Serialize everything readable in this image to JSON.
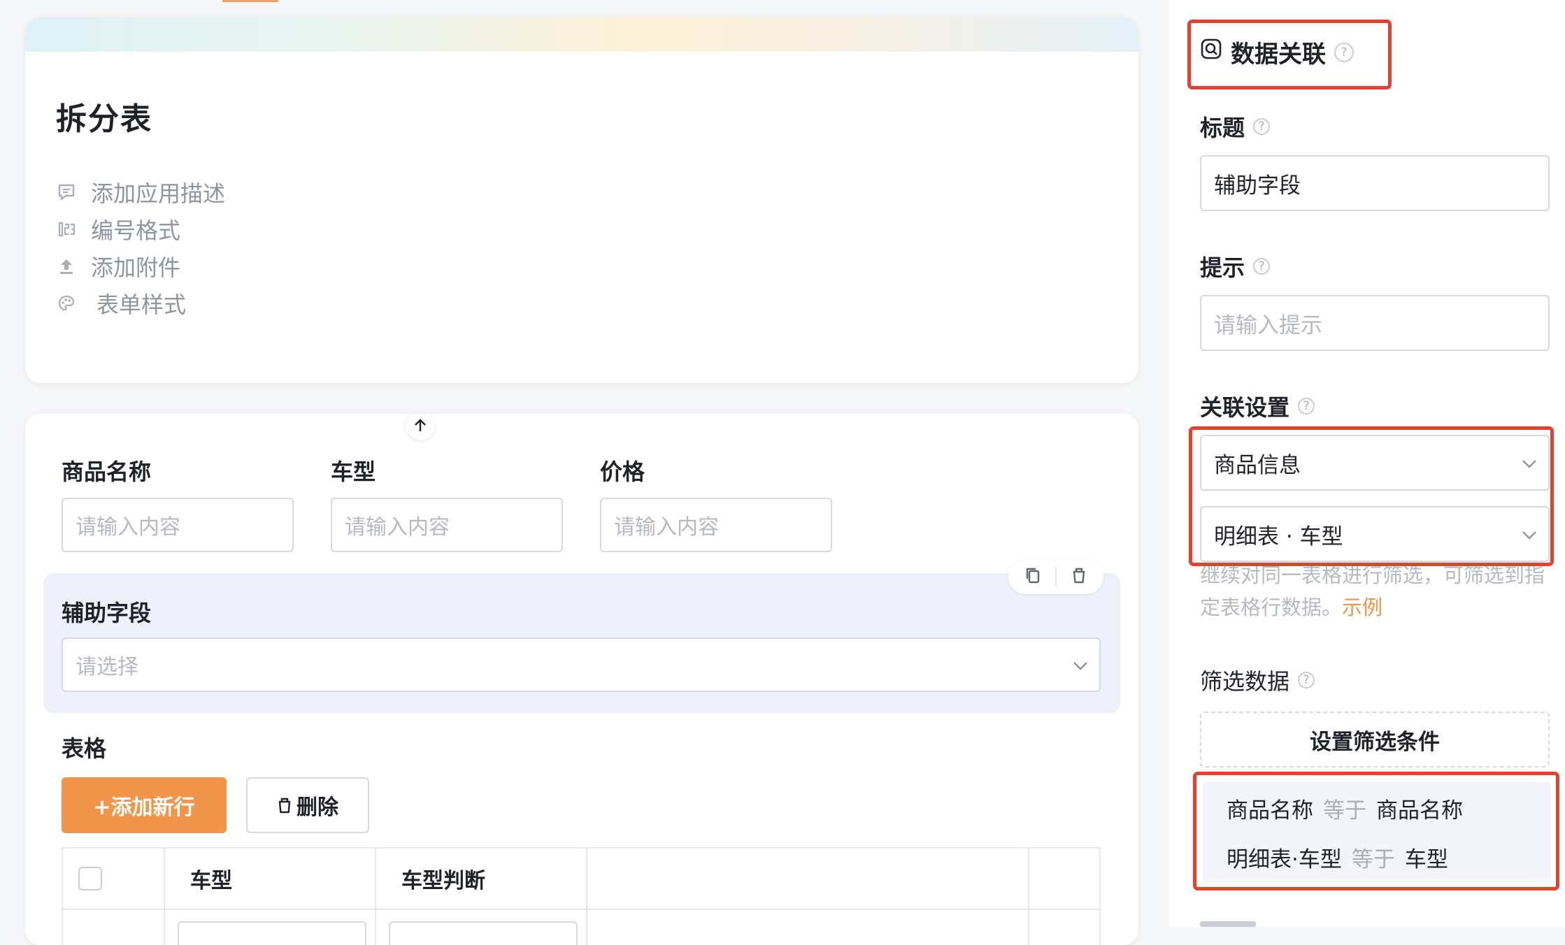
{
  "form": {
    "title": "拆分表",
    "meta": [
      {
        "icon": "comment-icon",
        "label": "添加应用描述"
      },
      {
        "icon": "number-format-icon",
        "label": "编号格式"
      },
      {
        "icon": "upload-icon",
        "label": "添加附件"
      },
      {
        "icon": "palette-icon",
        "label": "表单样式"
      }
    ]
  },
  "fields": [
    {
      "label": "商品名称",
      "placeholder": "请输入内容"
    },
    {
      "label": "车型",
      "placeholder": "请输入内容"
    },
    {
      "label": "价格",
      "placeholder": "请输入内容"
    }
  ],
  "selected_field": {
    "label": "辅助字段",
    "placeholder": "请选择",
    "toolbar_icons": [
      "copy-icon",
      "delete-icon"
    ],
    "move_icon": "arrow-up-icon"
  },
  "table": {
    "label": "表格",
    "add_row": "+添加新行",
    "delete": "删除",
    "columns": [
      "车型",
      "车型判断"
    ]
  },
  "panel": {
    "title": "数据关联",
    "title_icon": "data-link-icon",
    "title_label": "标题",
    "title_value": "辅助字段",
    "tip_label": "提示",
    "tip_placeholder": "请输入提示",
    "link_label": "关联设置",
    "link_source": "商品信息",
    "link_detail": "明细表 · 车型",
    "hint_text": "继续对同一表格进行筛选，可筛选到指定表格行数据。",
    "hint_link": "示例",
    "filter_label": "筛选数据",
    "filter_button": "设置筛选条件",
    "conditions": [
      {
        "left": "商品名称",
        "op": "等于",
        "right": "商品名称"
      },
      {
        "left": "明细表·车型",
        "op": "等于",
        "right": "车型"
      }
    ]
  },
  "colors": {
    "accent": "#f0954a",
    "highlight": "#e3402d",
    "selected_bg": "#eef1fb"
  }
}
